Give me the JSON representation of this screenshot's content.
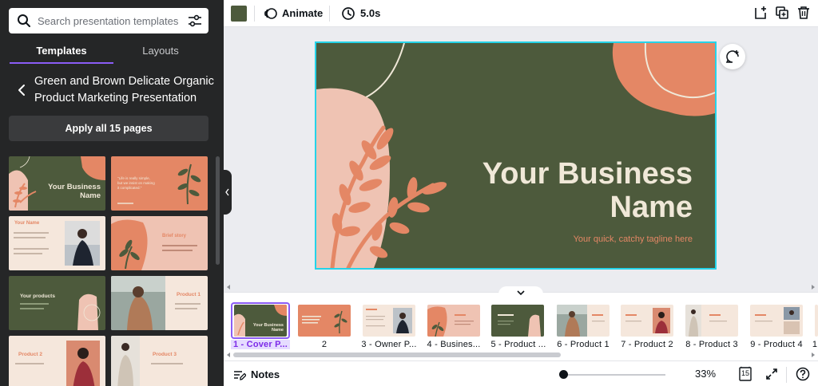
{
  "search": {
    "placeholder": "Search presentation templates"
  },
  "tabs": [
    {
      "label": "Templates"
    },
    {
      "label": "Layouts"
    }
  ],
  "template_title": "Green and Brown Delicate Organic Product Marketing Presentation",
  "apply_label": "Apply all 15 pages",
  "template_thumbs": [
    {
      "name": "thumb-cover",
      "text": [
        "Your Business",
        "Name"
      ]
    },
    {
      "name": "thumb-quote",
      "text": [
        "\"Life is really simple,",
        "but we insist on making",
        "it complicated.\""
      ]
    },
    {
      "name": "thumb-your-name",
      "text": [
        "Your Name"
      ]
    },
    {
      "name": "thumb-brief-story",
      "text": [
        "Brief story"
      ]
    },
    {
      "name": "thumb-your-products",
      "text": [
        "Your products"
      ]
    },
    {
      "name": "thumb-product-1",
      "text": [
        "Product 1"
      ]
    },
    {
      "name": "thumb-product-2",
      "text": [
        "Product 2"
      ]
    },
    {
      "name": "thumb-product-3",
      "text": [
        "Product 3"
      ]
    }
  ],
  "toolbar": {
    "color": "#4d5a3c",
    "animate_label": "Animate",
    "duration_label": "5.0s"
  },
  "slide": {
    "title_line1": "Your Business",
    "title_line2": "Name",
    "tagline": "Your quick, catchy tagline here",
    "colors": {
      "background": "#4d5a3c",
      "accent": "#e48765",
      "blush": "#efc3b3",
      "text": "#f0e8d8",
      "selection": "#25d3e8"
    }
  },
  "pages": [
    {
      "label": "1 - Cover P..."
    },
    {
      "label": "2"
    },
    {
      "label": "3 - Owner P..."
    },
    {
      "label": "4 - Busines..."
    },
    {
      "label": "5 - Product ..."
    },
    {
      "label": "6 - Product 1"
    },
    {
      "label": "7 - Product 2"
    },
    {
      "label": "8 - Product 3"
    },
    {
      "label": "9 - Product 4"
    },
    {
      "label": "1"
    }
  ],
  "bottombar": {
    "notes_label": "Notes",
    "zoom_label": "33%",
    "page_count": "15"
  },
  "icons": [
    "search-icon",
    "filter-icon",
    "chevron-left-icon",
    "animate-icon",
    "clock-icon",
    "add-page-icon",
    "duplicate-icon",
    "trash-icon",
    "comment-add-icon",
    "chevron-down-icon",
    "notes-icon",
    "pages-icon",
    "fullscreen-icon",
    "help-icon"
  ]
}
